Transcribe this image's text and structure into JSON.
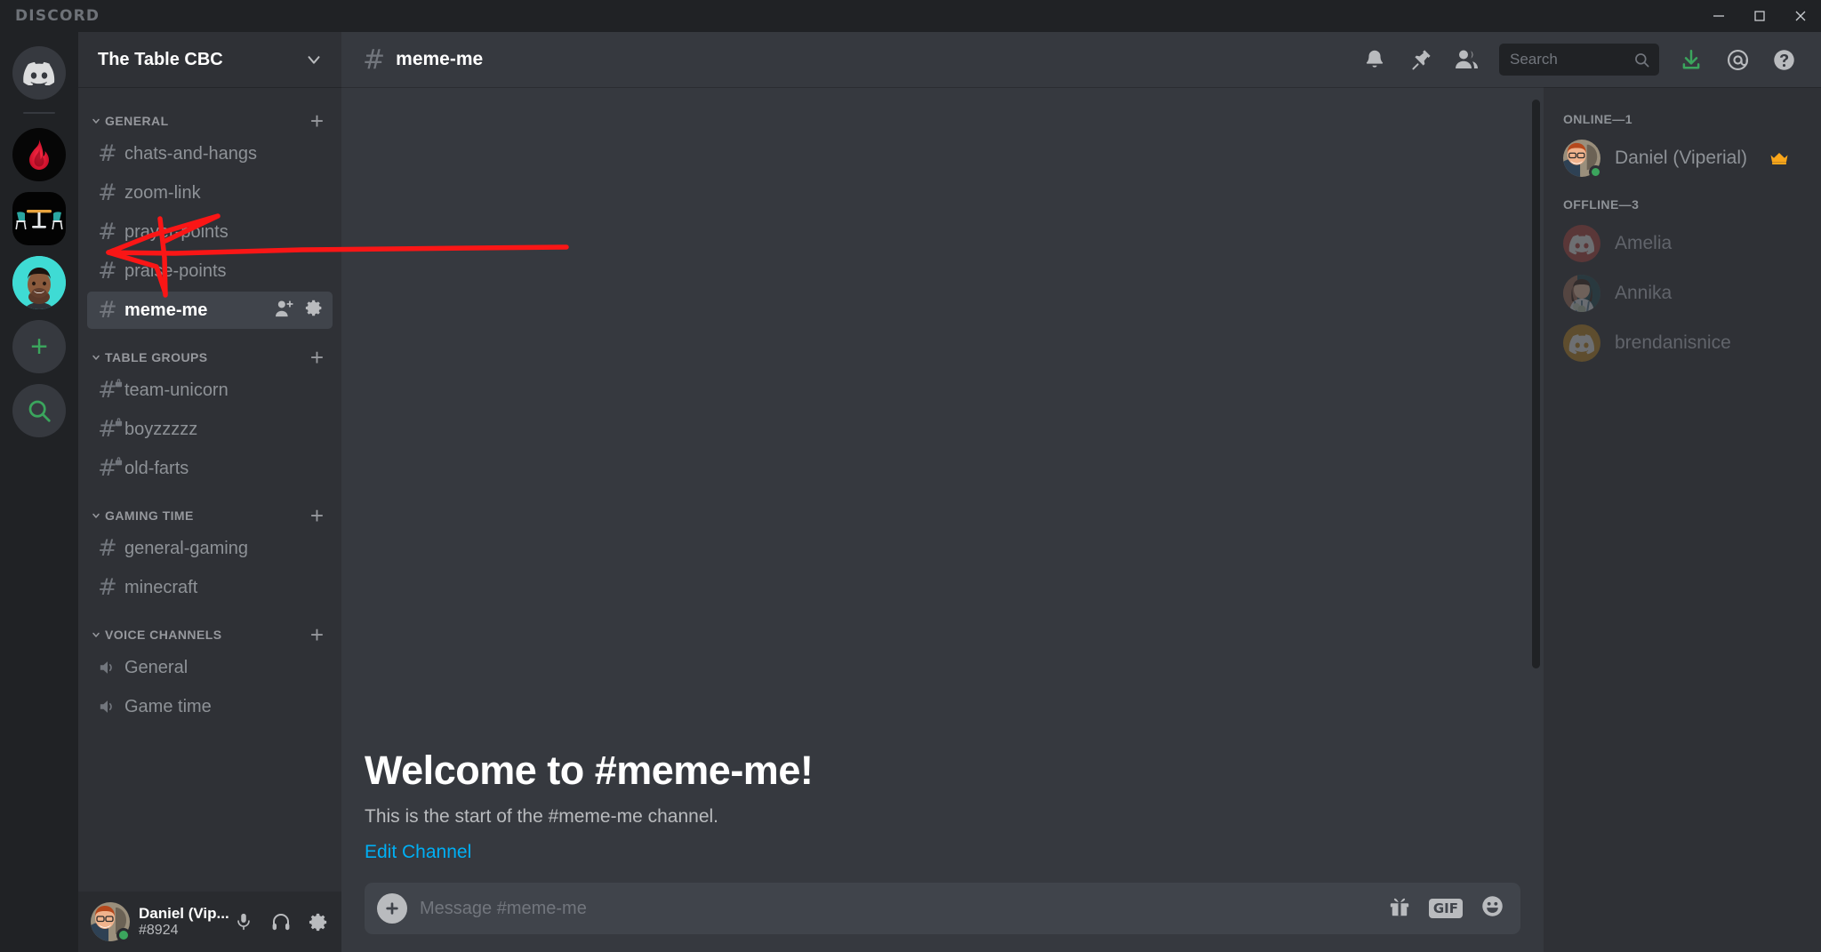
{
  "titlebar": {
    "brand": "DISCORD",
    "minimize": "Minimize",
    "maximize": "Maximize",
    "close": "Close"
  },
  "rail": {
    "servers": [
      {
        "name": "Discord Home",
        "icon": "discord-logo-icon",
        "type": "home"
      },
      {
        "name": "Flame Server",
        "icon": "flame-icon",
        "type": "flame"
      },
      {
        "name": "The Table CBC",
        "icon": "table-icon",
        "type": "table",
        "active": true
      },
      {
        "name": "Direct Server",
        "icon": "person-avatar",
        "type": "person",
        "unread": true
      }
    ],
    "add_server_label": "+",
    "explore_label": "Explore Public Servers"
  },
  "sidebar": {
    "server_name": "The Table CBC",
    "categories": [
      {
        "name": "GENERAL",
        "channels": [
          {
            "name": "chats-and-hangs",
            "type": "text",
            "private": false
          },
          {
            "name": "zoom-link",
            "type": "text",
            "private": false
          },
          {
            "name": "prayer-points",
            "type": "text",
            "private": false
          },
          {
            "name": "praise-points",
            "type": "text",
            "private": false
          },
          {
            "name": "meme-me",
            "type": "text",
            "private": false,
            "active": true
          }
        ]
      },
      {
        "name": "TABLE GROUPS",
        "channels": [
          {
            "name": "team-unicorn",
            "type": "text",
            "private": true
          },
          {
            "name": "boyzzzzz",
            "type": "text",
            "private": true
          },
          {
            "name": "old-farts",
            "type": "text",
            "private": true
          }
        ]
      },
      {
        "name": "GAMING TIME",
        "channels": [
          {
            "name": "general-gaming",
            "type": "text",
            "private": false
          },
          {
            "name": "minecraft",
            "type": "text",
            "private": false
          }
        ]
      },
      {
        "name": "VOICE CHANNELS",
        "channels": [
          {
            "name": "General",
            "type": "voice",
            "private": false
          },
          {
            "name": "Game time",
            "type": "voice",
            "private": false
          }
        ]
      }
    ],
    "add_channel_label": "+"
  },
  "user_panel": {
    "name": "Daniel (Vip...",
    "tag": "#8924",
    "status": "online",
    "mute_label": "Mute",
    "deafen_label": "Deafen",
    "settings_label": "User Settings"
  },
  "channel_header": {
    "hash": "#",
    "title": "meme-me",
    "actions": [
      {
        "name": "notifications-icon",
        "label": "Notification Settings"
      },
      {
        "name": "pin-icon",
        "label": "Pinned Messages"
      },
      {
        "name": "members-icon",
        "label": "Member List"
      }
    ],
    "trailing_actions": [
      {
        "name": "inbox-icon",
        "label": "Inbox"
      },
      {
        "name": "mentions-icon",
        "label": "Mentions"
      },
      {
        "name": "help-icon",
        "label": "Help"
      }
    ]
  },
  "search": {
    "placeholder": "Search",
    "value": ""
  },
  "welcome": {
    "title": "Welcome to #meme-me!",
    "subtitle": "This is the start of the #meme-me channel.",
    "edit_link": "Edit Channel"
  },
  "composer": {
    "placeholder": "Message #meme-me",
    "add_label": "+",
    "gift_label": "Send a gift",
    "gif_label": "GIF",
    "emoji_label": "Select emoji"
  },
  "members": {
    "groups": [
      {
        "label": "ONLINE—1",
        "status": "online",
        "people": [
          {
            "name": "Daniel (Viperial)",
            "avatar": "photo-daniel",
            "owner": true,
            "status": "online"
          }
        ]
      },
      {
        "label": "OFFLINE—3",
        "status": "offline",
        "people": [
          {
            "name": "Amelia",
            "avatar": "discord-default-red",
            "owner": false,
            "status": "offline"
          },
          {
            "name": "Annika",
            "avatar": "photo-annika",
            "owner": false,
            "status": "offline"
          },
          {
            "name": "brendanisnice",
            "avatar": "discord-default-gold",
            "owner": false,
            "status": "offline"
          }
        ]
      }
    ]
  },
  "annotation": {
    "type": "hand-drawn-arrow",
    "color": "#fa1616",
    "target": "zoom-link",
    "description": "Red arrow pointing left toward the channel sidebar"
  }
}
